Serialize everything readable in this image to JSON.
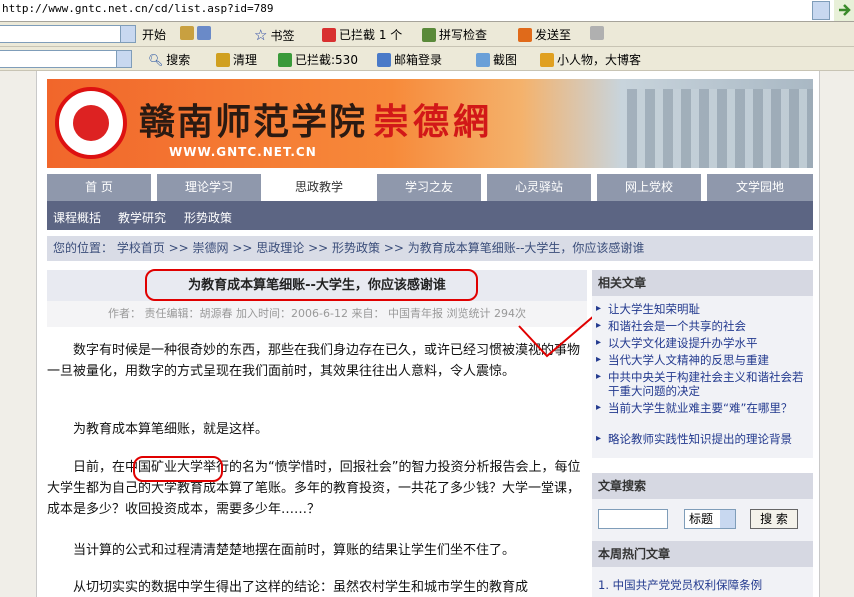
{
  "browser": {
    "address": "http://www.gntc.net.cn/cd/list.asp?id=789",
    "toolbar1": {
      "start": "开始",
      "bookmarks": "书签",
      "blocked": "已拦截 1 个",
      "spellcheck": "拼写检查",
      "send_to": "发送至"
    },
    "toolbar2": {
      "search": "搜索",
      "clean": "清理",
      "blocked_count": "已拦截:530",
      "mail_login": "邮箱登录",
      "screenshot": "截图",
      "blog": "小人物，大博客"
    }
  },
  "banner": {
    "title": "赣南师范学院",
    "subtitle": "崇德網",
    "url": "WWW.GNTC.NET.CN"
  },
  "nav": [
    "首 页",
    "理论学习",
    "思政教学",
    "学习之友",
    "心灵驿站",
    "网上党校",
    "文学园地"
  ],
  "subnav": [
    "课程概括",
    "教学研究",
    "形势政策"
  ],
  "breadcrumb": "您的位置： 学校首页 >> 崇德网 >> 思政理论 >> 形势政策 >> 为教育成本算笔细账--大学生，你应该感谢谁",
  "article": {
    "title": "为教育成本算笔细账--大学生，你应该感谢谁",
    "meta": "作者： 责任编辑：胡源春   加入时间：2006-6-12  来自： 中国青年报 浏览统计 294次",
    "paragraphs": [
      "数字有时候是一种很奇妙的东西，那些在我们身边存在已久，或许已经习惯被漠视的事物一旦被量化，用数字的方式呈现在我们面前时，其效果往往出人意料，令人震惊。",
      "为教育成本算笔细账，就是这样。",
      "日前，在中国矿业大学举行的名为“愤学惜时，回报社会”的智力投资分析报告会上，每位大学生都为自己的大学教育成本算了笔账。多年的教育投资，一共花了多少钱？大学一堂课，成本是多少？收回投资成本，需要多少年……？",
      "当计算的公式和过程清清楚楚地摆在面前时，算账的结果让学生们坐不住了。",
      "从切切实实的数据中学生得出了这样的结论：虽然农村学生和城市学生的教育成"
    ]
  },
  "sidebar": {
    "related_title": "相关文章",
    "related": [
      "让大学生知荣明耻",
      "和谐社会是一个共享的社会",
      "以大学文化建设提升办学水平",
      "当代大学人文精神的反思与重建",
      "中共中央关于构建社会主义和谐社会若干重大问题的决定",
      "当前大学生就业难主要“难”在哪里？",
      "略论教师实践性知识提出的理论背景"
    ],
    "search_title": "文章搜索",
    "search_field": "标题",
    "search_button": "搜 索",
    "hot_title": "本周热门文章",
    "hot": [
      "1. 中国共产党党员权利保障条例"
    ]
  }
}
